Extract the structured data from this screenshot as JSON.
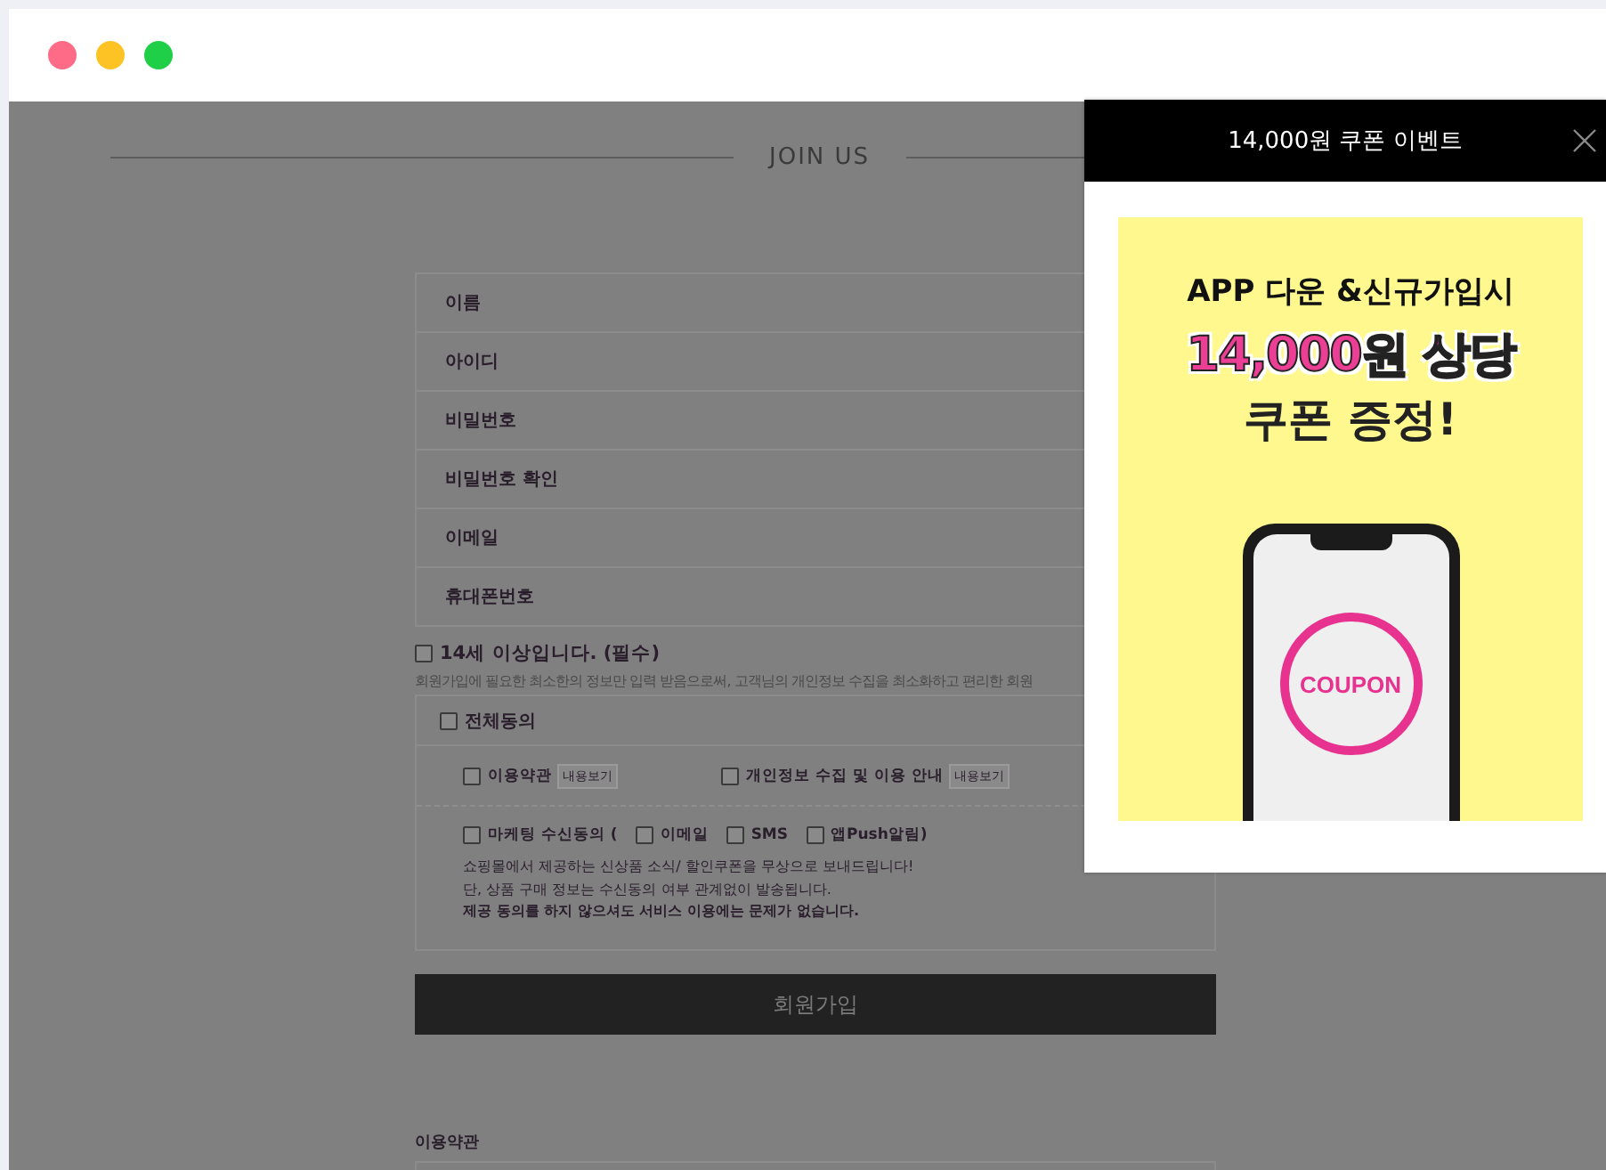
{
  "page": {
    "heading": "JOIN US"
  },
  "fields": [
    {
      "label": "이름"
    },
    {
      "label": "아이디"
    },
    {
      "label": "비밀번호"
    },
    {
      "label": "비밀번호 확인"
    },
    {
      "label": "이메일"
    },
    {
      "label": "휴대폰번호"
    }
  ],
  "age_check": {
    "label": "14세 이상입니다. (필수)",
    "checked": false
  },
  "notice": "회원가입에 필요한 최소한의 정보만 입력 받음으로써, 고객님의 개인정보 수집을 최소화하고 편리한 회원",
  "agreement": {
    "all": {
      "label": "전체동의",
      "checked": false
    },
    "items": [
      {
        "label": "이용약관",
        "checked": false,
        "button": "내용보기"
      },
      {
        "label": "개인정보 수집 및 이용 안내",
        "checked": false,
        "button": "내용보기"
      }
    ],
    "marketing": {
      "label": "마케팅 수신동의 (",
      "checked": false,
      "channels": [
        {
          "label": "이메일",
          "checked": false
        },
        {
          "label": "SMS",
          "checked": false
        },
        {
          "label": "앱Push알림)",
          "checked": false
        }
      ]
    },
    "lines": [
      "쇼핑몰에서 제공하는 신상품 소식/ 할인쿠폰을 무상으로 보내드립니다!",
      "단, 상품 구매 정보는 수신동의 여부 관계없이 발송됩니다.",
      "**제공 동의를 하지 않으셔도 서비스 이용에는 문제가 없습니다.**"
    ]
  },
  "submit": "회원가입",
  "terms_heading": "이용약관",
  "popup": {
    "title": "14,000원 쿠폰 이벤트",
    "banner": {
      "line_1": "APP 다운 &신규가입시",
      "line_2": "14,000원 상당",
      "line_3": "쿠폰 증정!",
      "coupon": "COUPON"
    }
  }
}
